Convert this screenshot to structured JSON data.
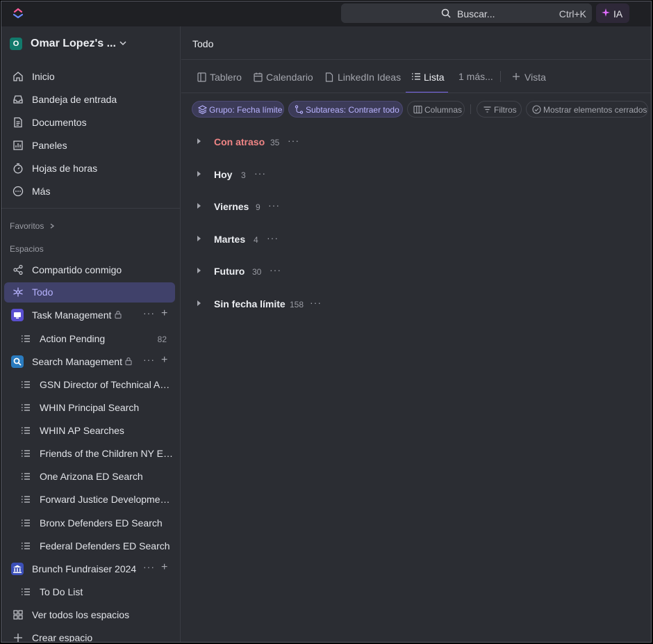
{
  "topbar": {
    "search_label": "Buscar...",
    "search_shortcut": "Ctrl+K",
    "ai_label": "IA"
  },
  "workspace": {
    "badge": "O",
    "name": "Omar Lopez's ..."
  },
  "sidebar": {
    "nav": [
      {
        "label": "Inicio",
        "icon": "home-icon"
      },
      {
        "label": "Bandeja de entrada",
        "icon": "inbox-icon"
      },
      {
        "label": "Documentos",
        "icon": "document-icon"
      },
      {
        "label": "Paneles",
        "icon": "dashboard-icon"
      },
      {
        "label": "Hojas de horas",
        "icon": "timer-icon"
      },
      {
        "label": "Más",
        "icon": "more-icon"
      }
    ],
    "favorites_label": "Favoritos",
    "spaces_label": "Espacios",
    "shared_label": "Compartido conmigo",
    "everything_label": "Todo",
    "spaces": [
      {
        "name": "Task Management",
        "icon_color": "#5a4fcf",
        "lists": [
          {
            "name": "Action Pending",
            "count": "82"
          }
        ]
      },
      {
        "name": "Search Management",
        "icon_color": "#2a7bbf",
        "lists": [
          {
            "name": "GSN Director of Technical Assi..."
          },
          {
            "name": "WHIN Principal Search"
          },
          {
            "name": "WHIN AP Searches"
          },
          {
            "name": "Friends of the Children NY ED..."
          },
          {
            "name": "One Arizona ED Search"
          },
          {
            "name": "Forward Justice Development ..."
          },
          {
            "name": "Bronx Defenders ED Search"
          },
          {
            "name": "Federal Defenders ED Search"
          }
        ]
      },
      {
        "name": "Brunch Fundraiser 2024",
        "icon_color": "#3b4fb8",
        "lists": [
          {
            "name": "To Do List"
          }
        ]
      }
    ],
    "view_all_spaces": "Ver todos los espacios",
    "create_space": "Crear espacio"
  },
  "main": {
    "title": "Todo",
    "tabs": [
      {
        "label": "Tablero"
      },
      {
        "label": "Calendario"
      },
      {
        "label": "LinkedIn Ideas"
      },
      {
        "label": "Lista"
      },
      {
        "label": "1 más..."
      },
      {
        "label": "Vista"
      }
    ],
    "chips": {
      "group": "Grupo: Fecha límite",
      "subtasks": "Subtareas: Contraer todo",
      "columns": "Columnas",
      "filters": "Filtros",
      "show_closed": "Mostrar elementos cerrados"
    },
    "groups": [
      {
        "name": "Con atraso",
        "count": "35"
      },
      {
        "name": "Hoy",
        "count": "3"
      },
      {
        "name": "Viernes",
        "count": "9"
      },
      {
        "name": "Martes",
        "count": "4"
      },
      {
        "name": "Futuro",
        "count": "30"
      },
      {
        "name": "Sin fecha límite",
        "count": "158"
      }
    ]
  },
  "colors": {
    "accent": "#7b68ee",
    "overdue": "#f08585",
    "workspace_badge": "#127a6c"
  }
}
